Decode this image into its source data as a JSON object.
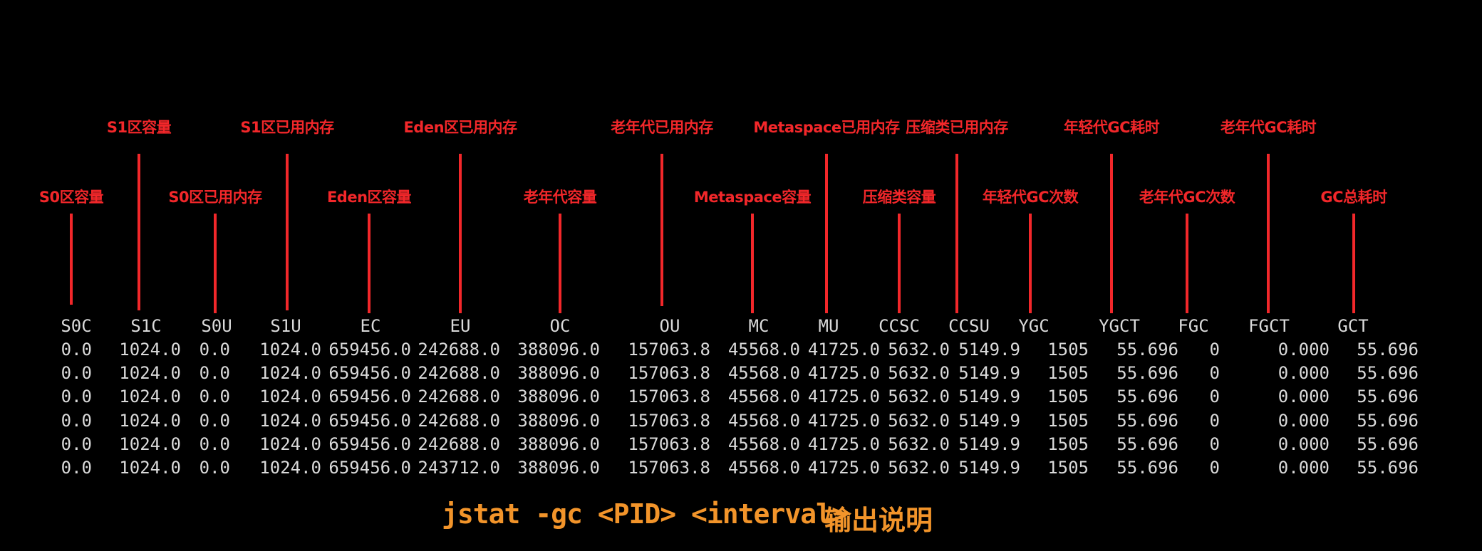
{
  "columns": [
    {
      "key": "S0C",
      "annotation": "S0区容量"
    },
    {
      "key": "S1C",
      "annotation": "S1区容量"
    },
    {
      "key": "S0U",
      "annotation": "S0区已用内存"
    },
    {
      "key": "S1U",
      "annotation": "S1区已用内存"
    },
    {
      "key": "EC",
      "annotation": "Eden区容量"
    },
    {
      "key": "EU",
      "annotation": "Eden区已用内存"
    },
    {
      "key": "OC",
      "annotation": "老年代容量"
    },
    {
      "key": "OU",
      "annotation": "老年代已用内存"
    },
    {
      "key": "MC",
      "annotation": "Metaspace容量"
    },
    {
      "key": "MU",
      "annotation": "Metaspace已用内存"
    },
    {
      "key": "CCSC",
      "annotation": "压缩类容量"
    },
    {
      "key": "CCSU",
      "annotation": "压缩类已用内存"
    },
    {
      "key": "YGC",
      "annotation": "年轻代GC次数"
    },
    {
      "key": "YGCT",
      "annotation": "年轻代GC耗时"
    },
    {
      "key": "FGC",
      "annotation": "老年代GC次数"
    },
    {
      "key": "FGCT",
      "annotation": "老年代GC耗时"
    },
    {
      "key": "GCT",
      "annotation": "GC总耗时"
    }
  ],
  "rows": [
    [
      "0.0",
      "1024.0",
      "0.0",
      "1024.0",
      "659456.0",
      "242688.0",
      "388096.0",
      "157063.8",
      "45568.0",
      "41725.0",
      "5632.0",
      "5149.9",
      "1505",
      "55.696",
      "0",
      "0.000",
      "55.696"
    ],
    [
      "0.0",
      "1024.0",
      "0.0",
      "1024.0",
      "659456.0",
      "242688.0",
      "388096.0",
      "157063.8",
      "45568.0",
      "41725.0",
      "5632.0",
      "5149.9",
      "1505",
      "55.696",
      "0",
      "0.000",
      "55.696"
    ],
    [
      "0.0",
      "1024.0",
      "0.0",
      "1024.0",
      "659456.0",
      "242688.0",
      "388096.0",
      "157063.8",
      "45568.0",
      "41725.0",
      "5632.0",
      "5149.9",
      "1505",
      "55.696",
      "0",
      "0.000",
      "55.696"
    ],
    [
      "0.0",
      "1024.0",
      "0.0",
      "1024.0",
      "659456.0",
      "242688.0",
      "388096.0",
      "157063.8",
      "45568.0",
      "41725.0",
      "5632.0",
      "5149.9",
      "1505",
      "55.696",
      "0",
      "0.000",
      "55.696"
    ],
    [
      "0.0",
      "1024.0",
      "0.0",
      "1024.0",
      "659456.0",
      "242688.0",
      "388096.0",
      "157063.8",
      "45568.0",
      "41725.0",
      "5632.0",
      "5149.9",
      "1505",
      "55.696",
      "0",
      "0.000",
      "55.696"
    ],
    [
      "0.0",
      "1024.0",
      "0.0",
      "1024.0",
      "659456.0",
      "243712.0",
      "388096.0",
      "157063.8",
      "45568.0",
      "41725.0",
      "5632.0",
      "5149.9",
      "1505",
      "55.696",
      "0",
      "0.000",
      "55.696"
    ]
  ],
  "caption": {
    "command": "jstat -gc <PID> <interval>",
    "description": "输出说明"
  },
  "colors": {
    "background": "#000000",
    "annotation": "#f2272a",
    "terminal_text": "#dadada",
    "caption": "#f2942a"
  }
}
